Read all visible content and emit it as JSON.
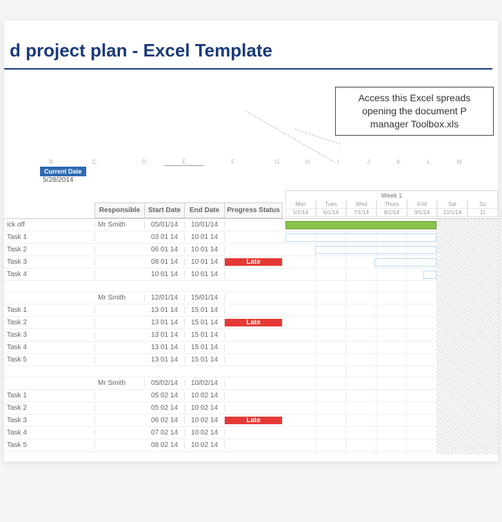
{
  "title": "d project plan - Excel Template",
  "callout": {
    "line1": "Access this Excel spreads",
    "line2": "opening the document P",
    "line3": "manager Toolbox.xls"
  },
  "column_letters": [
    "B",
    "C",
    "D",
    "E",
    "F",
    "G",
    "H",
    "I",
    "J",
    "K",
    "L",
    "M"
  ],
  "current_date_label": "Current Date",
  "current_date_value": "5/28/2014",
  "table_headers": {
    "responsible": "Responsible",
    "start_date": "Start Date",
    "end_date": "End Date",
    "progress_status": "Progress Status"
  },
  "week_label": "Week 1",
  "days": [
    "Mon",
    "Tues",
    "Wed",
    "Thurs",
    "Frid",
    "Sat",
    "Su"
  ],
  "dates": [
    "5/1/14",
    "6/1/14",
    "7/1/14",
    "8/1/14",
    "9/1/14",
    "10/1/14",
    "11"
  ],
  "groups": [
    {
      "rows": [
        {
          "task": "ick off",
          "resp": "Mr Smith",
          "sd": "05/01/14",
          "ed": "10/01/14",
          "status": "yellow",
          "label": ""
        },
        {
          "task": "Task 1",
          "resp": "",
          "sd": "03 01 14",
          "ed": "10 01 14",
          "status": "yellow",
          "label": ""
        },
        {
          "task": "Task 2",
          "resp": "",
          "sd": "06 01 14",
          "ed": "10 01 14",
          "status": "green",
          "label": ""
        },
        {
          "task": "Task 3",
          "resp": "",
          "sd": "08 01 14",
          "ed": "10 01 14",
          "status": "red",
          "label": "Late"
        },
        {
          "task": "Task 4",
          "resp": "",
          "sd": "10 01 14",
          "ed": "10 01 14",
          "status": "yellow",
          "label": ""
        }
      ]
    },
    {
      "rows": [
        {
          "task": "",
          "resp": "Mr Smith",
          "sd": "12/01/14",
          "ed": "15/01/14",
          "status": "",
          "label": ""
        },
        {
          "task": "Task 1",
          "resp": "",
          "sd": "13 01 14",
          "ed": "15 01 14",
          "status": "yellow",
          "label": ""
        },
        {
          "task": "Task 2",
          "resp": "",
          "sd": "13 01 14",
          "ed": "15 01 14",
          "status": "red",
          "label": "Late"
        },
        {
          "task": "Task 3",
          "resp": "",
          "sd": "13 01 14",
          "ed": "15 01 14",
          "status": "green",
          "label": ""
        },
        {
          "task": "Task 4",
          "resp": "",
          "sd": "13 01 14",
          "ed": "15 01 14",
          "status": "yellow",
          "label": ""
        },
        {
          "task": "Task 5",
          "resp": "",
          "sd": "13 01 14",
          "ed": "15 01 14",
          "status": "yellow",
          "label": ""
        }
      ]
    },
    {
      "rows": [
        {
          "task": "",
          "resp": "Mr Smith",
          "sd": "05/02/14",
          "ed": "10/02/14",
          "status": "",
          "label": ""
        },
        {
          "task": "Task 1",
          "resp": "",
          "sd": "05 02 14",
          "ed": "10 02 14",
          "status": "yellow",
          "label": ""
        },
        {
          "task": "Task 2",
          "resp": "",
          "sd": "05 02 14",
          "ed": "10 02 14",
          "status": "green",
          "label": ""
        },
        {
          "task": "Task 3",
          "resp": "",
          "sd": "06 02 14",
          "ed": "10 02 14",
          "status": "red",
          "label": "Late"
        },
        {
          "task": "Task 4",
          "resp": "",
          "sd": "07 02 14",
          "ed": "10 02 14",
          "status": "yellow",
          "label": ""
        },
        {
          "task": "Task 5",
          "resp": "",
          "sd": "08 02 14",
          "ed": "10 02 14",
          "status": "yellow",
          "label": ""
        }
      ]
    }
  ]
}
